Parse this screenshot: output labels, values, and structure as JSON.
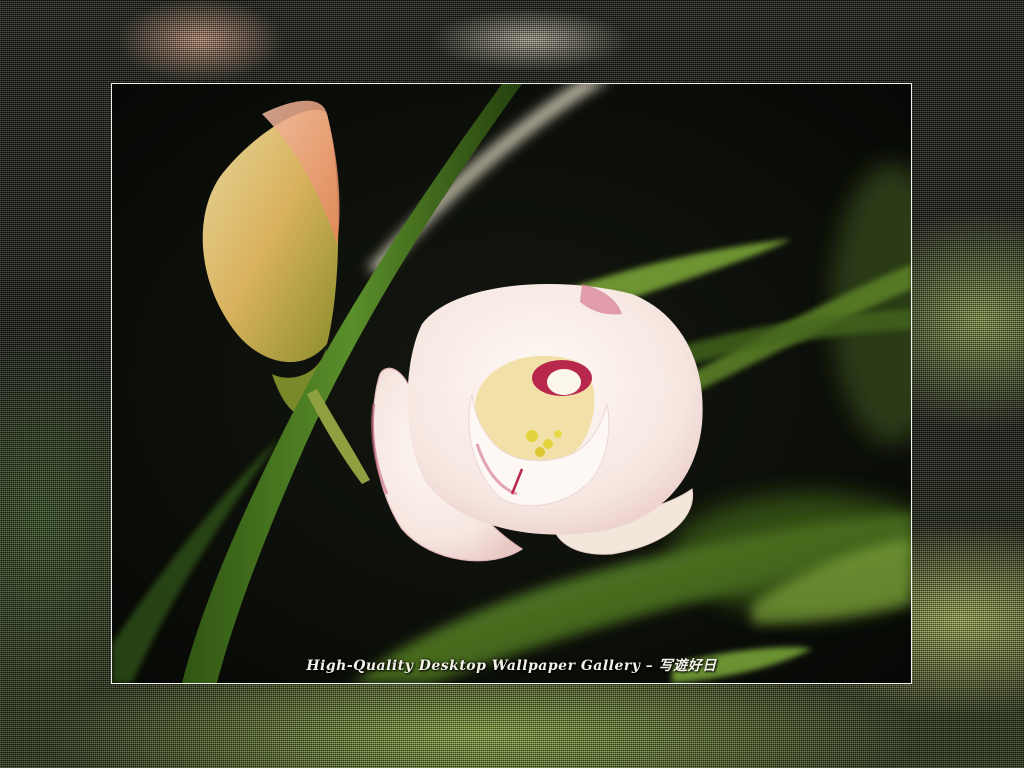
{
  "wallpaper": {
    "caption": "High-Quality Desktop Wallpaper Gallery – 写遊好日",
    "subject": "flower-icon",
    "colors": {
      "background": "#0a0c08",
      "petal": "#f5ece6",
      "lip_accent": "#b8284c",
      "leaf": "#4f7a22",
      "frame_border": "#f2f2f2"
    }
  }
}
